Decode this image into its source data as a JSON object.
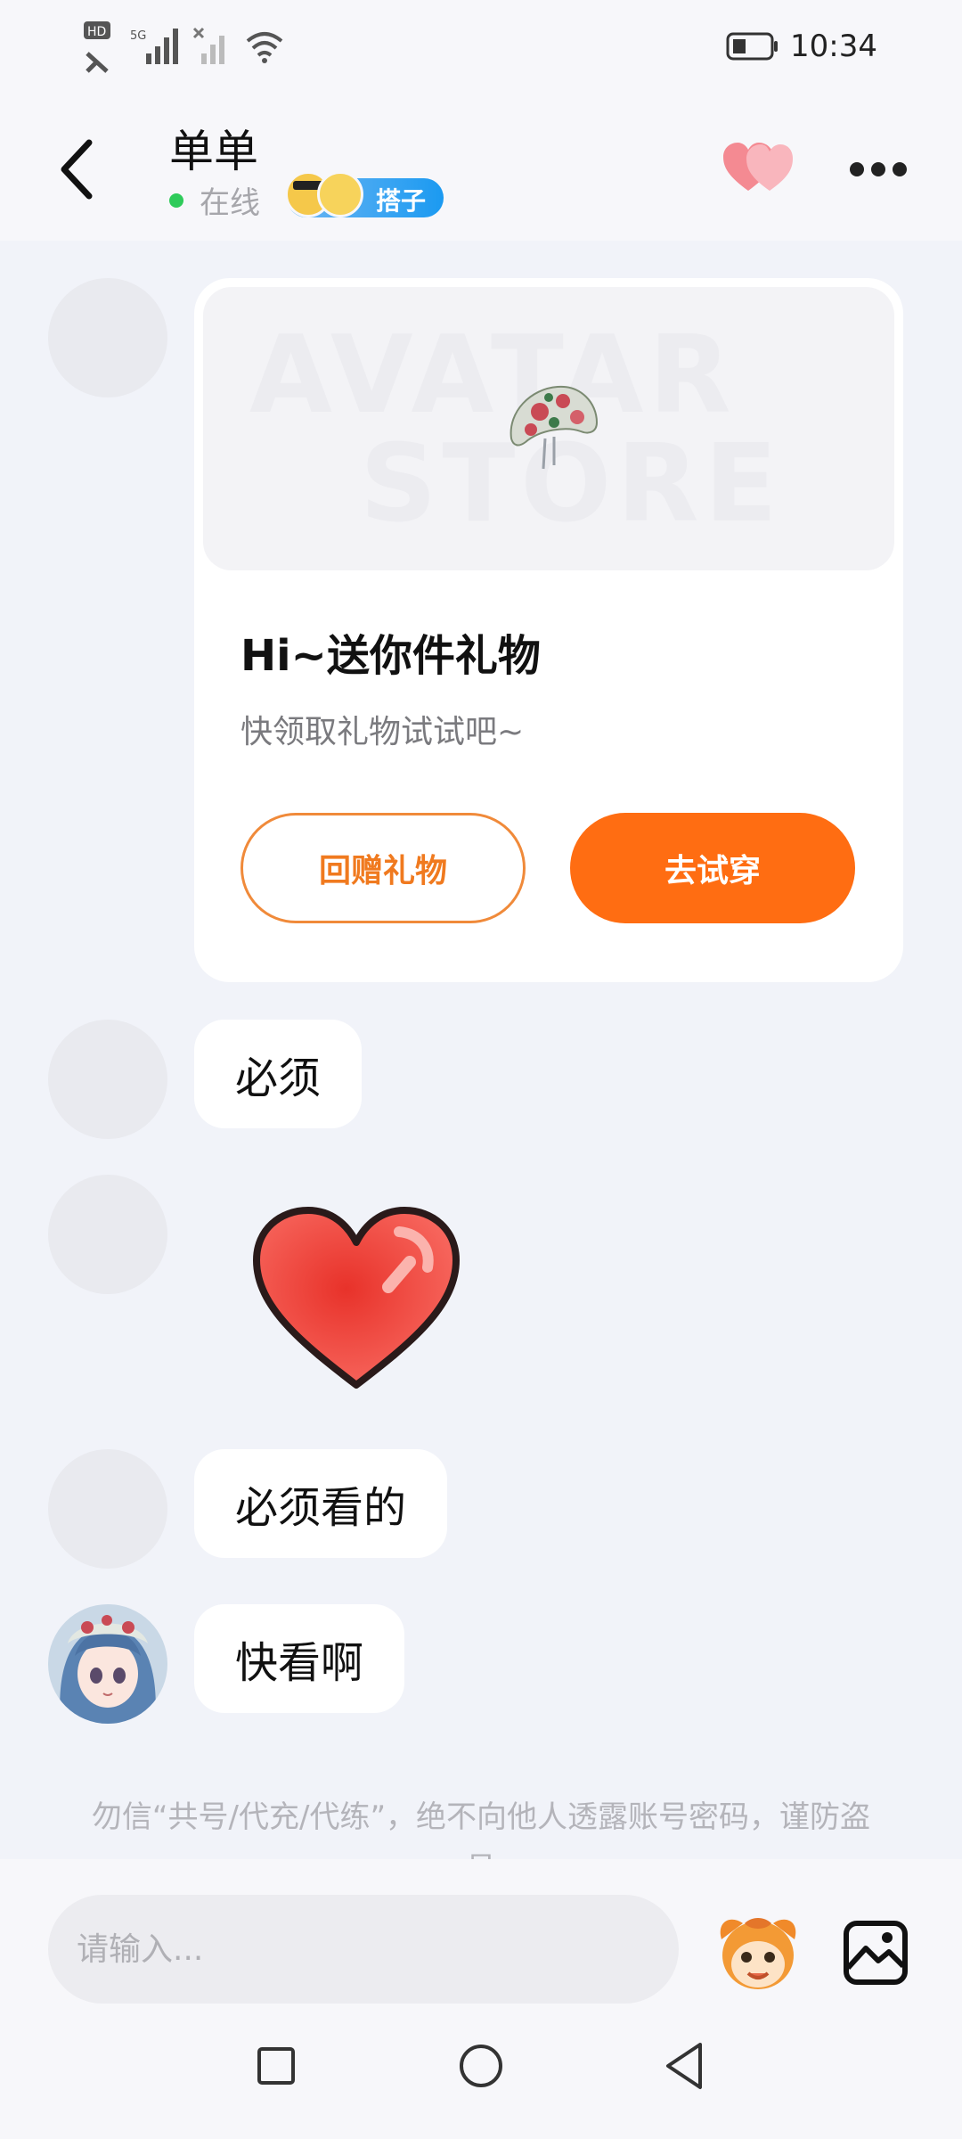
{
  "status_bar": {
    "hd_label": "HD",
    "net_label": "5G",
    "sim1": "1",
    "sim2": "2",
    "battery_icon": "battery-icon",
    "time": "10:34"
  },
  "header": {
    "back_icon": "chevron-left-icon",
    "contact_name": "单单",
    "online_status": "在线",
    "badge_label": "搭子",
    "hearts_icon": "double-heart-icon",
    "more_icon": "ellipsis-icon",
    "online_color": "#2fcb5a"
  },
  "gift_card": {
    "watermark_line1": "AVATAR",
    "watermark_line2": "STORE",
    "title": "Hi~送你件礼物",
    "subtitle": "快领取礼物试试吧~",
    "return_gift_label": "回赠礼物",
    "try_on_label": "去试穿",
    "accent_color": "#ff6d12"
  },
  "messages": [
    {
      "text": "必须"
    },
    {
      "sticker": "red-heart"
    },
    {
      "text": "必须看的"
    },
    {
      "text": "快看啊"
    }
  ],
  "notice": {
    "text": "勿信“共号/代充/代练”，绝不向他人透露账号密码，谨防盗号"
  },
  "input_bar": {
    "placeholder": "请输入...",
    "mascot_icon": "mascot-icon",
    "image_icon": "image-icon"
  },
  "nav_bar": {
    "recents_icon": "square-icon",
    "home_icon": "circle-icon",
    "back_icon": "triangle-back-icon"
  }
}
